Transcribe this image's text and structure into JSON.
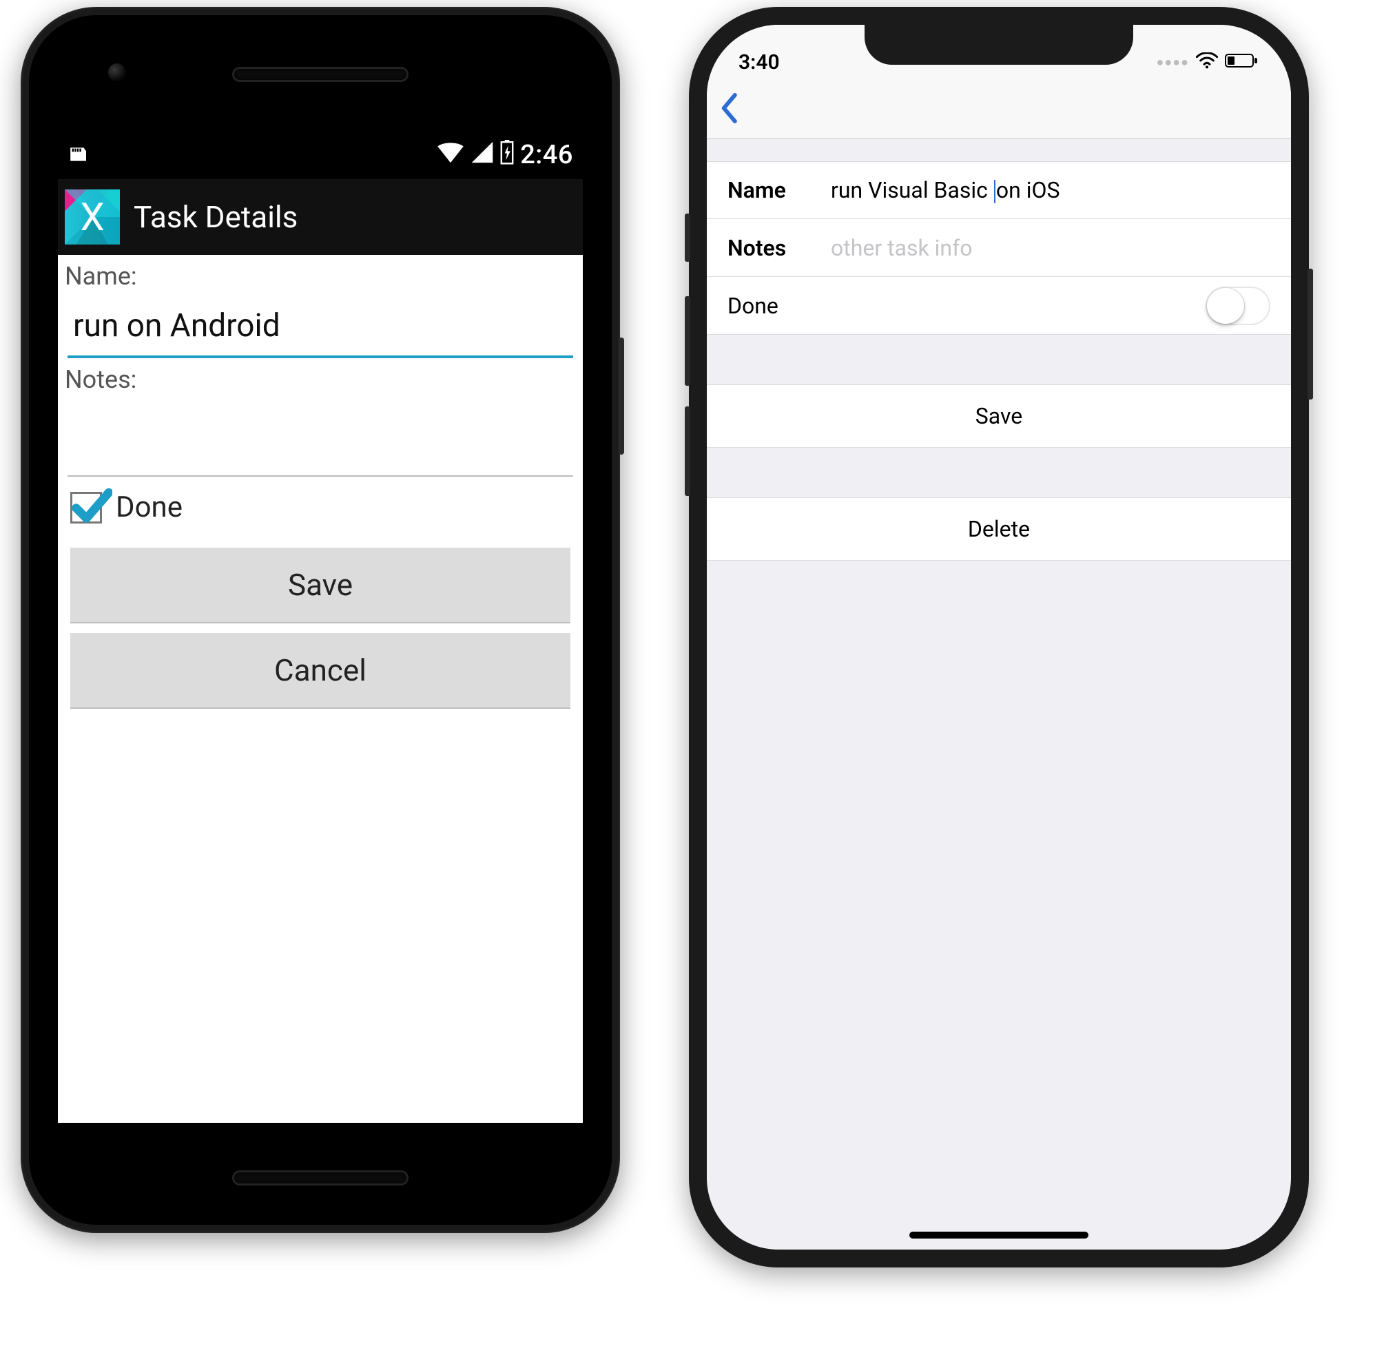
{
  "android": {
    "status": {
      "clock": "2:46"
    },
    "appbar": {
      "title": "Task Details"
    },
    "form": {
      "name_label": "Name:",
      "name_value": "run on Android",
      "notes_label": "Notes:",
      "notes_value": "",
      "done_label": "Done",
      "done_checked": true
    },
    "buttons": {
      "save": "Save",
      "cancel": "Cancel"
    }
  },
  "ios": {
    "status": {
      "clock": "3:40"
    },
    "rows": {
      "name_label": "Name",
      "name_value_before": "run Visual Basic ",
      "name_value_after": "on iOS",
      "notes_label": "Notes",
      "notes_placeholder": "other task info",
      "done_label": "Done",
      "done_on": false
    },
    "buttons": {
      "save": "Save",
      "delete": "Delete"
    }
  }
}
